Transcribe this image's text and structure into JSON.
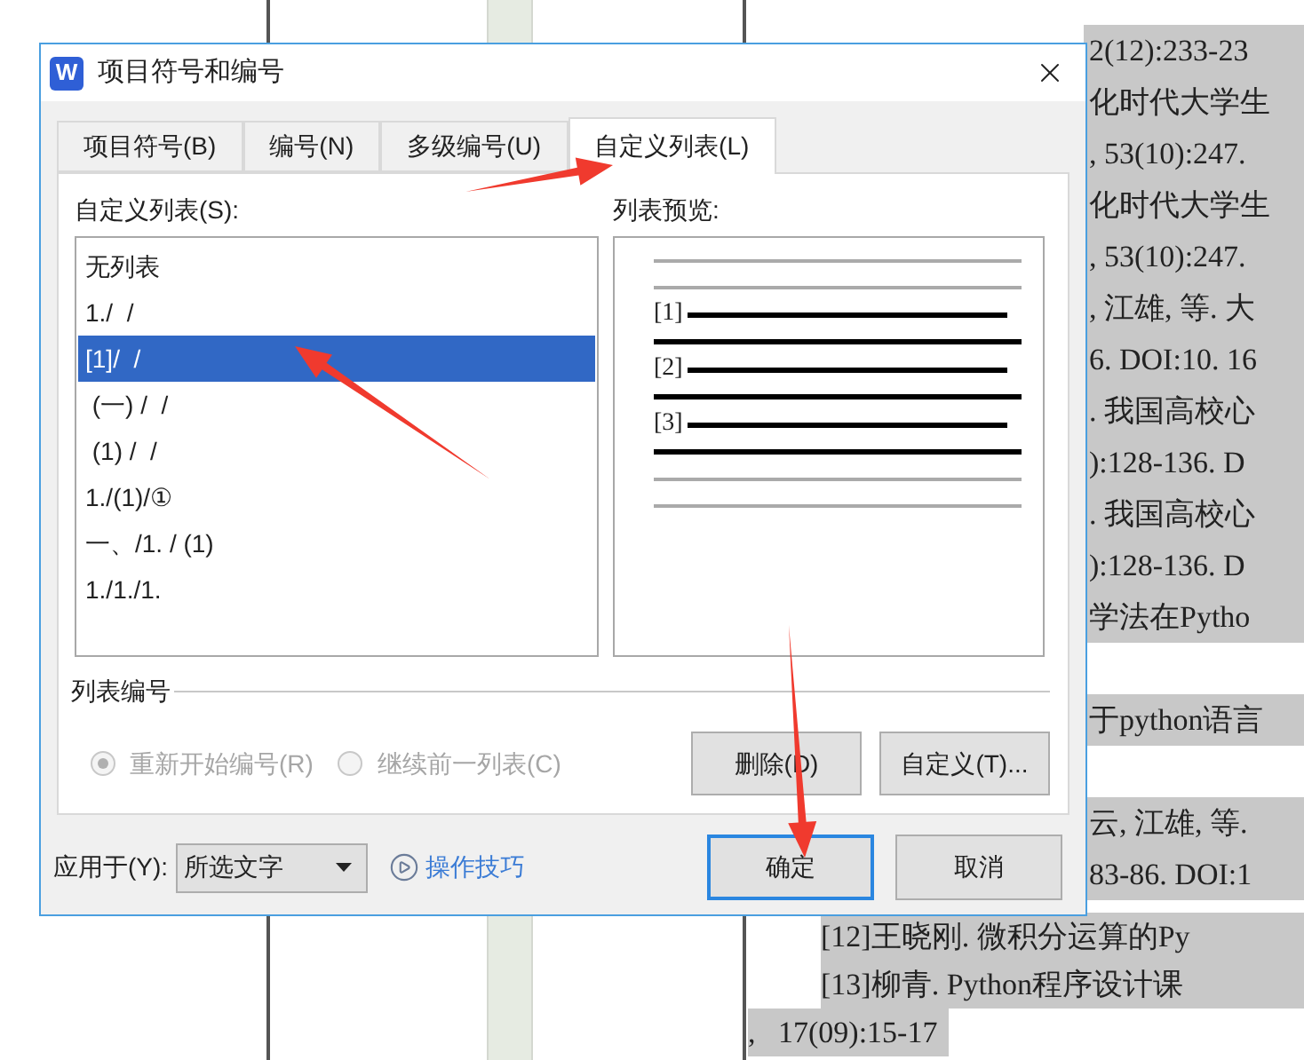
{
  "document": {
    "side_lines": [
      {
        "kind": "text",
        "text": "2(12):233-23"
      },
      {
        "kind": "text",
        "text": "化时代大学生"
      },
      {
        "kind": "text",
        "text": ", 53(10):247."
      },
      {
        "kind": "text",
        "text": "化时代大学生"
      },
      {
        "kind": "text",
        "text": ", 53(10):247."
      },
      {
        "kind": "text",
        "text": ", 江雄, 等. 大"
      },
      {
        "kind": "text",
        "text": "6. DOI:10. 16"
      },
      {
        "kind": "text",
        "text": ". 我国高校心"
      },
      {
        "kind": "text",
        "text": "):128-136. D"
      },
      {
        "kind": "text",
        "text": ". 我国高校心"
      },
      {
        "kind": "text",
        "text": "):128-136. D"
      },
      {
        "kind": "text",
        "text": "学法在Pytho"
      },
      {
        "kind": "blank"
      },
      {
        "kind": "text",
        "text": "于python语言"
      },
      {
        "kind": "blank"
      },
      {
        "kind": "text",
        "text": "云, 江雄, 等. "
      },
      {
        "kind": "text",
        "text": "83-86. DOI:1"
      }
    ],
    "bottom_lines": [
      {
        "text": "[12]王晓刚. 微积分运算的Py",
        "indented": true
      },
      {
        "text": "[13]柳青. Python程序设计课",
        "indented": true
      },
      {
        "text": ",   17(09):15-17",
        "indented": false
      }
    ]
  },
  "dialog": {
    "app_icon_letter": "W",
    "title": "项目符号和编号",
    "tabs": [
      {
        "label": "项目符号(B)",
        "selected": false
      },
      {
        "label": "编号(N)",
        "selected": false
      },
      {
        "label": "多级编号(U)",
        "selected": false
      },
      {
        "label": "自定义列表(L)",
        "selected": true
      }
    ],
    "custom_list": {
      "label": "自定义列表(S):",
      "items": [
        {
          "text": "无列表",
          "selected": false
        },
        {
          "text": "1./  /",
          "selected": false
        },
        {
          "text": "[1]/  /",
          "selected": true
        },
        {
          "text": " (一) /  /",
          "selected": false
        },
        {
          "text": " (1) /  /",
          "selected": false
        },
        {
          "text": "1./(1)/①",
          "selected": false
        },
        {
          "text": "一、/1. / (1)",
          "selected": false
        },
        {
          "text": "1./1./1.",
          "selected": false
        }
      ]
    },
    "preview": {
      "label": "列表预览:",
      "markers": [
        "[1]",
        "[2]",
        "[3]"
      ]
    },
    "numbering": {
      "label": "列表编号",
      "options": [
        {
          "label": "重新开始编号(R)",
          "selected": true,
          "disabled": true
        },
        {
          "label": "继续前一列表(C)",
          "selected": false,
          "disabled": true
        }
      ],
      "buttons": [
        "删除(D)",
        "自定义(T)..."
      ]
    },
    "apply_to": {
      "label": "应用于(Y):",
      "value": "所选文字"
    },
    "tips_link": "操作技巧",
    "footer_buttons": [
      {
        "label": "确定",
        "default": true
      },
      {
        "label": "取消",
        "default": false
      }
    ]
  }
}
